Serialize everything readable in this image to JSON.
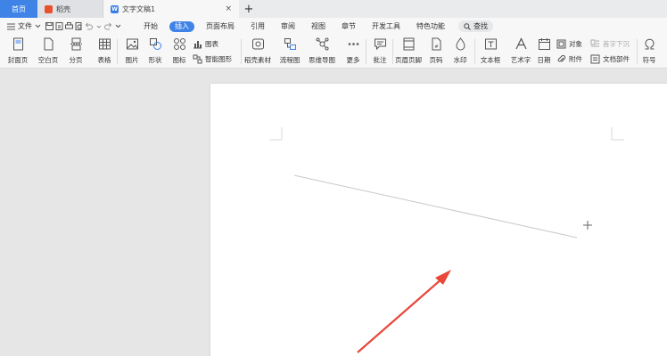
{
  "tabs": {
    "home": "首页",
    "daoke": "稻壳",
    "document": "文字文稿1",
    "close_glyph": "×",
    "new_glyph": "+"
  },
  "menubar": {
    "file": "文件",
    "tabs": [
      "开始",
      "插入",
      "页面布局",
      "引用",
      "审阅",
      "视图",
      "章节",
      "开发工具",
      "特色功能"
    ],
    "active_tab": "插入",
    "search": "查找"
  },
  "ribbon": {
    "cover_page": "封面页",
    "blank_page": "空白页",
    "page_break": "分页",
    "table": "表格",
    "picture": "图片",
    "shapes": "形状",
    "icons": "图标",
    "chart": "图表",
    "smart_art": "智能图形",
    "daoke_material": "稻壳素材",
    "flowchart": "流程图",
    "mind_map": "思维导图",
    "more": "更多",
    "comment": "批注",
    "header_footer": "页眉页脚",
    "page_number": "页码",
    "watermark": "水印",
    "text_box": "文本框",
    "word_art": "艺术字",
    "date": "日期",
    "object": "对象",
    "drop_cap": "首字下沉",
    "attachment": "附件",
    "doc_parts": "文档部件",
    "symbol": "符号"
  },
  "colors": {
    "accent": "#3f83e6",
    "arrow": "#e8473a",
    "daoke_logo": "#e8512c"
  }
}
